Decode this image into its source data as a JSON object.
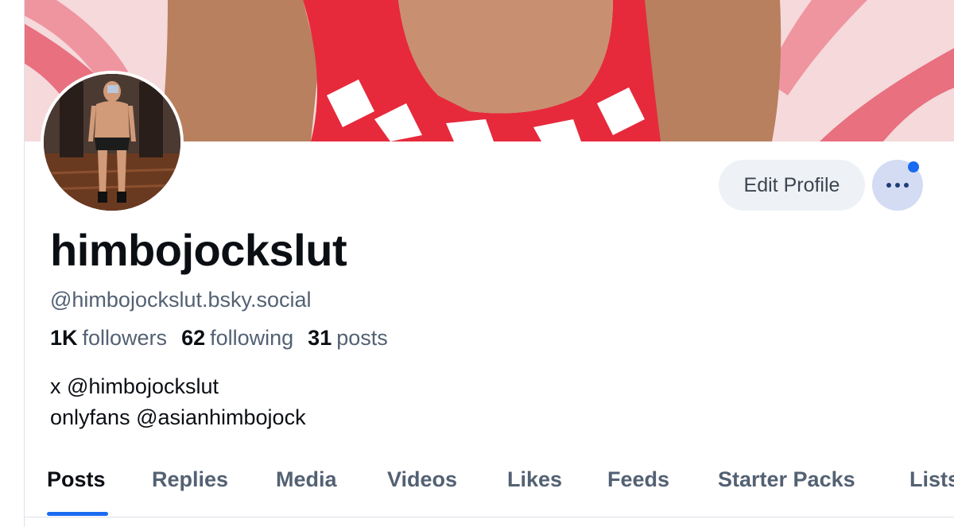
{
  "profile": {
    "display_name": "himbojockslut",
    "handle": "@himbojockslut.bsky.social",
    "stats": {
      "followers_count": "1K",
      "followers_label": "followers",
      "following_count": "62",
      "following_label": "following",
      "posts_count": "31",
      "posts_label": "posts"
    },
    "bio": {
      "line1": "x @himbojockslut",
      "line2": "onlyfans @asianhimbojock"
    }
  },
  "actions": {
    "edit_profile_label": "Edit Profile",
    "more_icon": "ellipsis-icon",
    "notification_dot_color": "#1b6bf2"
  },
  "tabs": [
    {
      "label": "Posts",
      "active": true
    },
    {
      "label": "Replies",
      "active": false
    },
    {
      "label": "Media",
      "active": false
    },
    {
      "label": "Videos",
      "active": false
    },
    {
      "label": "Likes",
      "active": false
    },
    {
      "label": "Feeds",
      "active": false
    },
    {
      "label": "Starter Packs",
      "active": false
    },
    {
      "label": "Lists",
      "active": false
    }
  ],
  "colors": {
    "accent": "#1b6bf2",
    "text_primary": "#0b0f14",
    "text_secondary": "#536173",
    "banner_pink": "#e8707f",
    "singlet_red": "#e62a3c"
  }
}
